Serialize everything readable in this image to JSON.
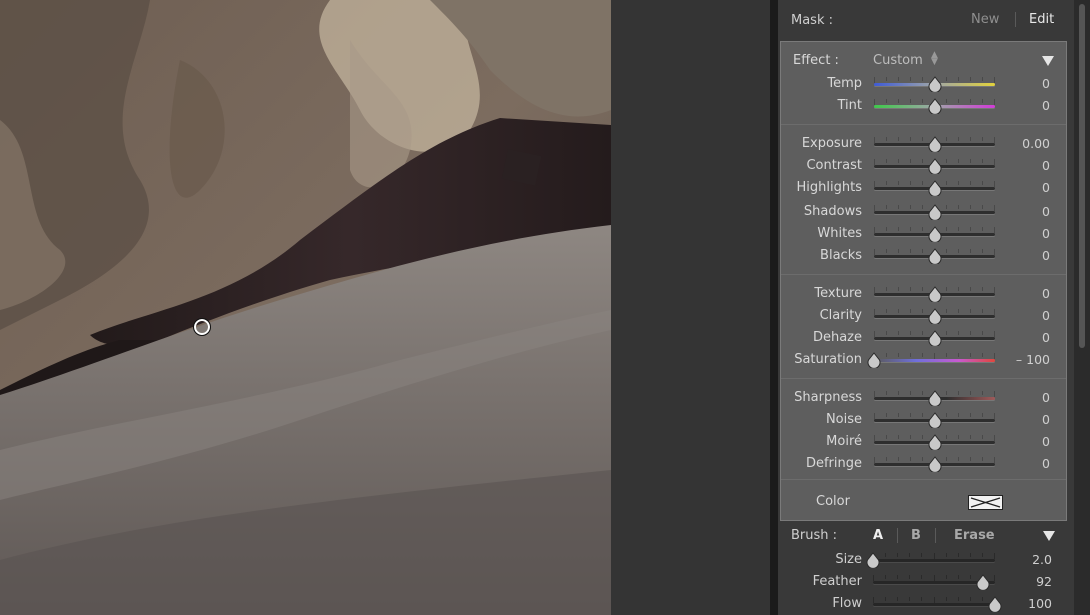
{
  "mask": {
    "label": "Mask :",
    "new_label": "New",
    "edit_label": "Edit"
  },
  "effect": {
    "label": "Effect :",
    "preset": "Custom",
    "groups": [
      [
        {
          "id": "temp",
          "label": "Temp",
          "value": "0",
          "position": 0.5,
          "track": "temp"
        },
        {
          "id": "tint",
          "label": "Tint",
          "value": "0",
          "position": 0.5,
          "track": "tint"
        }
      ],
      [
        {
          "id": "exposure",
          "label": "Exposure",
          "value": "0.00",
          "position": 0.5,
          "track": "dark"
        },
        {
          "id": "contrast",
          "label": "Contrast",
          "value": "0",
          "position": 0.5,
          "track": "dark"
        },
        {
          "id": "highlights",
          "label": "Highlights",
          "value": "0",
          "position": 0.5,
          "track": "dark"
        },
        {
          "id": "shadows",
          "label": "Shadows",
          "value": "0",
          "position": 0.5,
          "track": "dark"
        },
        {
          "id": "whites",
          "label": "Whites",
          "value": "0",
          "position": 0.5,
          "track": "dark"
        },
        {
          "id": "blacks",
          "label": "Blacks",
          "value": "0",
          "position": 0.5,
          "track": "dark"
        }
      ],
      [
        {
          "id": "texture",
          "label": "Texture",
          "value": "0",
          "position": 0.5,
          "track": "dark"
        },
        {
          "id": "clarity",
          "label": "Clarity",
          "value": "0",
          "position": 0.5,
          "track": "dark"
        },
        {
          "id": "dehaze",
          "label": "Dehaze",
          "value": "0",
          "position": 0.5,
          "track": "dark"
        },
        {
          "id": "saturation",
          "label": "Saturation",
          "value": "– 100",
          "position": 0.0,
          "track": "saturation"
        }
      ],
      [
        {
          "id": "sharpness",
          "label": "Sharpness",
          "value": "0",
          "position": 0.5,
          "track": "sharpness"
        },
        {
          "id": "noise",
          "label": "Noise",
          "value": "0",
          "position": 0.5,
          "track": "dark"
        },
        {
          "id": "moire",
          "label": "Moiré",
          "value": "0",
          "position": 0.5,
          "track": "dark"
        },
        {
          "id": "defringe",
          "label": "Defringe",
          "value": "0",
          "position": 0.5,
          "track": "dark"
        }
      ]
    ],
    "color_label": "Color"
  },
  "brush": {
    "label": "Brush :",
    "a_label": "A",
    "b_label": "B",
    "erase_label": "Erase",
    "sliders": [
      {
        "id": "size",
        "label": "Size",
        "value": "2.0",
        "position": 0.0
      },
      {
        "id": "feather",
        "label": "Feather",
        "value": "92",
        "position": 0.9
      },
      {
        "id": "flow",
        "label": "Flow",
        "value": "100",
        "position": 1.0
      }
    ]
  },
  "colors": {
    "panel_bg": "#393939",
    "effect_bg": "#5e5e5e",
    "text": "#d8d8d8"
  }
}
